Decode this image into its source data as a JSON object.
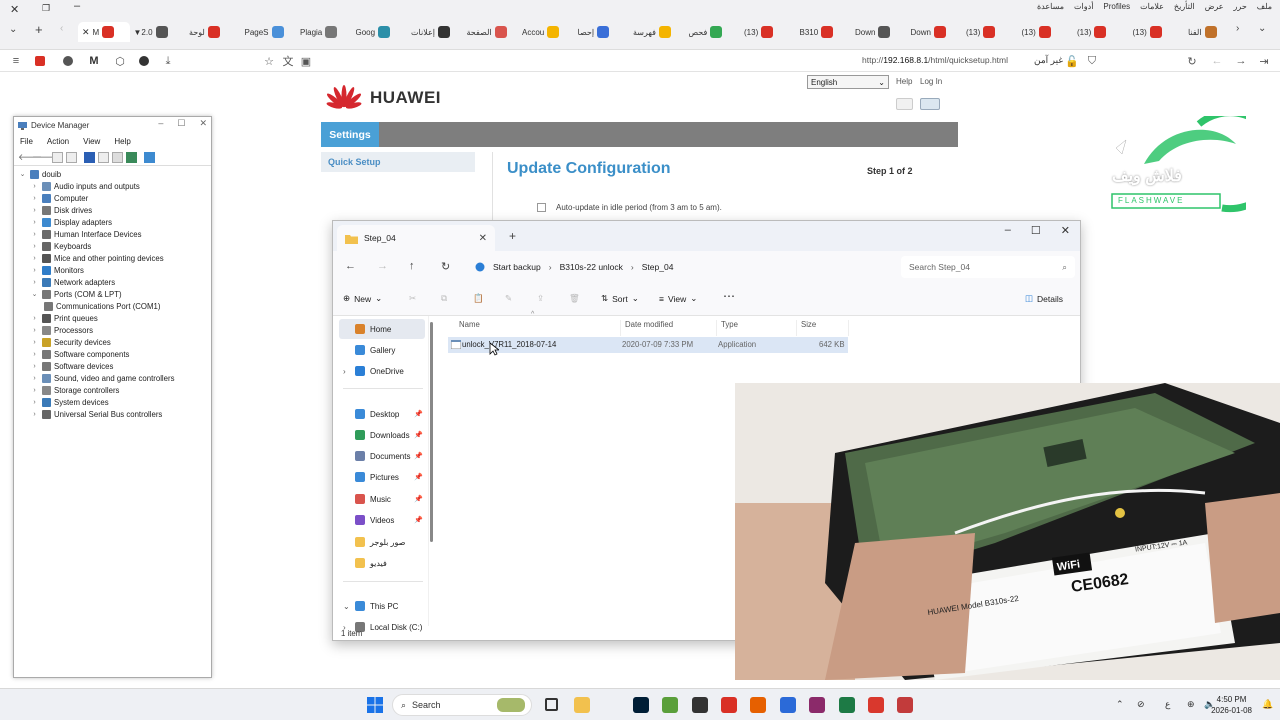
{
  "browser": {
    "menu_ar": [
      "ملف",
      "حرر",
      "عرض",
      "التأريخ",
      "علامات",
      "Profiles",
      "أدوات",
      "مساعدة"
    ],
    "tabs": [
      {
        "label": "M",
        "color": "#d93025"
      },
      {
        "label": "▼2.0",
        "color": "#555"
      },
      {
        "label": "لوحة",
        "color": "#d93025"
      },
      {
        "label": "PageS",
        "color": "#4a90d9"
      },
      {
        "label": "Plagia",
        "color": "#777"
      },
      {
        "label": "Goog",
        "color": "#2c8fa8"
      },
      {
        "label": "إعلانات",
        "color": "#333"
      },
      {
        "label": "الصفحة",
        "color": "#d9544d"
      },
      {
        "label": "Accou",
        "color": "#f4b400"
      },
      {
        "label": "إحصا",
        "color": "#3a6fd8"
      },
      {
        "label": "فهرسة",
        "color": "#f4b400"
      },
      {
        "label": "فحص",
        "color": "#34a853"
      },
      {
        "label": "(13)",
        "color": "#d93025"
      },
      {
        "label": "B310",
        "color": "#d93025"
      },
      {
        "label": "Down",
        "color": "#555"
      },
      {
        "label": "Down",
        "color": "#d93025"
      },
      {
        "label": "(13)",
        "color": "#d93025"
      },
      {
        "label": "(13)",
        "color": "#d93025"
      },
      {
        "label": "(13)",
        "color": "#d93025"
      },
      {
        "label": "(13)",
        "color": "#d93025"
      },
      {
        "label": "الفنا",
        "color": "#c0712a"
      }
    ],
    "url_prefix": "http://",
    "url_host": "192.168.8.1",
    "url_path": "/html/quicksetup.html",
    "secure_label": "غير آمن"
  },
  "router": {
    "brand": "HUAWEI",
    "language": "English",
    "help": "Help",
    "login": "Log In",
    "settings_tab": "Settings",
    "sidebar_item": "Quick Setup",
    "title": "Update Configuration",
    "step": "Step 1 of 2",
    "autoupdate_label": "Auto-update in idle period (from 3 am to 5 am)."
  },
  "device_manager": {
    "title": "Device Manager",
    "menu": [
      "File",
      "Action",
      "View",
      "Help"
    ],
    "root": "douib",
    "items": [
      {
        "label": "Audio inputs and outputs",
        "color": "#6b8fb8",
        "expanded": false
      },
      {
        "label": "Computer",
        "color": "#4a7fbd",
        "expanded": false
      },
      {
        "label": "Disk drives",
        "color": "#777",
        "expanded": false
      },
      {
        "label": "Display adapters",
        "color": "#3d8ad0",
        "expanded": false
      },
      {
        "label": "Human Interface Devices",
        "color": "#6a6a6a",
        "expanded": false
      },
      {
        "label": "Keyboards",
        "color": "#666",
        "expanded": false
      },
      {
        "label": "Mice and other pointing devices",
        "color": "#555",
        "expanded": false
      },
      {
        "label": "Monitors",
        "color": "#2f7dc9",
        "expanded": false
      },
      {
        "label": "Network adapters",
        "color": "#3a7ab8",
        "expanded": false
      },
      {
        "label": "Ports (COM & LPT)",
        "color": "#777",
        "expanded": true
      },
      {
        "label": "Communications Port (COM1)",
        "color": "#777",
        "child": true
      },
      {
        "label": "Print queues",
        "color": "#555",
        "expanded": false
      },
      {
        "label": "Processors",
        "color": "#888",
        "expanded": false
      },
      {
        "label": "Security devices",
        "color": "#c9a227",
        "expanded": false
      },
      {
        "label": "Software components",
        "color": "#777",
        "expanded": false
      },
      {
        "label": "Software devices",
        "color": "#777",
        "expanded": false
      },
      {
        "label": "Sound, video and game controllers",
        "color": "#6b8fb8",
        "expanded": false
      },
      {
        "label": "Storage controllers",
        "color": "#888",
        "expanded": false
      },
      {
        "label": "System devices",
        "color": "#3a7ab8",
        "expanded": false
      },
      {
        "label": "Universal Serial Bus controllers",
        "color": "#666",
        "expanded": false
      }
    ]
  },
  "explorer": {
    "tab_title": "Step_04",
    "breadcrumbs": [
      "Start backup",
      "B310s-22 unlock",
      "Step_04"
    ],
    "search_placeholder": "Search Step_04",
    "commands": {
      "new": "New",
      "sort": "Sort",
      "view": "View",
      "details": "Details"
    },
    "nav": [
      {
        "label": "Home",
        "color": "#d9822b",
        "selected": true
      },
      {
        "label": "Gallery",
        "color": "#3a8ad8"
      },
      {
        "label": "OneDrive",
        "color": "#2b7fd6"
      },
      {
        "label": "Desktop",
        "color": "#3a8ad8",
        "pinned": true
      },
      {
        "label": "Downloads",
        "color": "#2f9c5a",
        "pinned": true
      },
      {
        "label": "Documents",
        "color": "#6b7fa8",
        "pinned": true
      },
      {
        "label": "Pictures",
        "color": "#3a8ad8",
        "pinned": true
      },
      {
        "label": "Music",
        "color": "#d9544d",
        "pinned": true
      },
      {
        "label": "Videos",
        "color": "#7b4fc8",
        "pinned": true
      },
      {
        "label": "صور بلوجر",
        "color": "#f2c14e"
      },
      {
        "label": "فيديو",
        "color": "#f2c14e"
      },
      {
        "label": "This PC",
        "color": "#3a8ad8"
      },
      {
        "label": "Local Disk (C:)",
        "color": "#777"
      }
    ],
    "columns": [
      "Name",
      "Date modified",
      "Type",
      "Size"
    ],
    "files": [
      {
        "name": "unlock_V7R11_2018-07-14",
        "modified": "2020-07-09 7:33 PM",
        "type": "Application",
        "size": "642 KB"
      }
    ],
    "status": "1 item"
  },
  "watermark": {
    "line1": "فلاش ويف",
    "line2": "FLASHWAVE"
  },
  "photo": {
    "label_text": "HUAWEI  Model B310s-22",
    "wifi": "WiFi",
    "ce": "CE0682",
    "input": "INPUT:12V ⎓ 1A"
  },
  "taskbar": {
    "search_label": "Search",
    "time": "4:50 PM",
    "date": "2026-01-08",
    "lang": "ع",
    "apps": [
      {
        "name": "file-explorer",
        "color": "#f2c14e"
      },
      {
        "name": "photoshop",
        "color": "#001e36"
      },
      {
        "name": "krita",
        "color": "#5a9f3a"
      },
      {
        "name": "chatgpt",
        "color": "#333"
      },
      {
        "name": "chrome",
        "color": "#d93025"
      },
      {
        "name": "firefox",
        "color": "#e66000"
      },
      {
        "name": "shield",
        "color": "#2b6ad8"
      },
      {
        "name": "winrar",
        "color": "#8b2a6a"
      },
      {
        "name": "excel",
        "color": "#1d7a45"
      },
      {
        "name": "pdf",
        "color": "#d9382d"
      },
      {
        "name": "mail",
        "color": "#c23b3b"
      }
    ]
  }
}
